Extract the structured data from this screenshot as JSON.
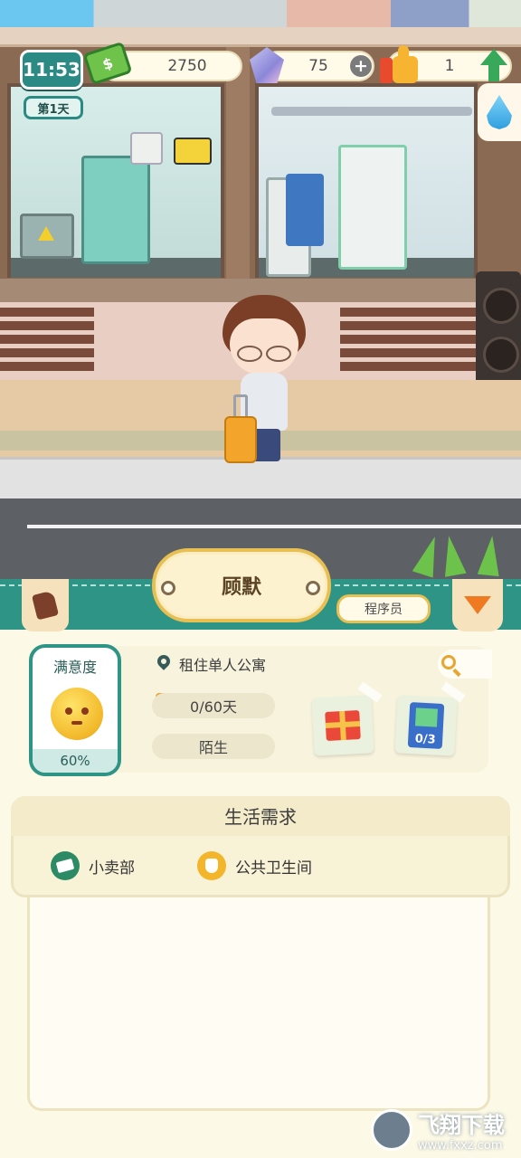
{
  "hud": {
    "time": "11:53",
    "day": "第1天",
    "money": "2750",
    "gems": "75",
    "likes": "1",
    "plus_label": "+"
  },
  "resident": {
    "name": "顾默",
    "occupation": "程序员",
    "satisfaction_label": "满意度",
    "satisfaction_value": "60%",
    "residence": "租住单人公寓",
    "stay_days": "0/60天",
    "relationship": "陌生",
    "book_count": "0/3"
  },
  "needs": {
    "title": "生活需求",
    "items": [
      {
        "label": "小卖部",
        "icon": "shop-icon"
      },
      {
        "label": "公共卫生间",
        "icon": "toilet-icon"
      }
    ]
  },
  "watermark": {
    "text": "飞翔下载",
    "domain": "www.fxxz.com"
  },
  "colors": {
    "teal": "#2e9485",
    "gold": "#e7bf52",
    "orange": "#f07a22",
    "cream": "#fcf9e6"
  }
}
